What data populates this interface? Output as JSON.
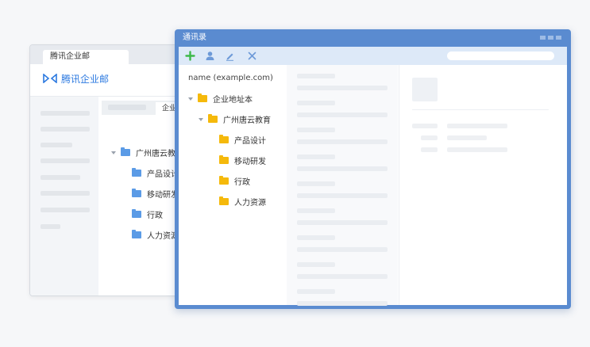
{
  "back_window": {
    "tab_title": "腾讯企业邮",
    "logo_text": "腾讯企业邮",
    "content_tab": "企业",
    "tree": {
      "root": "广州唐云教",
      "children": [
        "产品设计",
        "移动研发",
        "行政",
        "人力资源"
      ]
    }
  },
  "contacts_window": {
    "title": "通讯录",
    "toolbar": {
      "add_icon": "plus-icon",
      "user_icon": "user-icon",
      "edit_icon": "pen-icon",
      "delete_icon": "close-icon",
      "search_placeholder": ""
    },
    "tree": {
      "header": "name (example.com)",
      "root": "企业地址本",
      "org": "广州唐云教育",
      "departments": [
        "产品设计",
        "移动研发",
        "行政",
        "人力资源"
      ]
    }
  },
  "colors": {
    "window_blue": "#5a8bd0",
    "toolbar_blue": "#dde9f8",
    "folder_yellow": "#f5b90b",
    "folder_blue": "#5b9be6",
    "add_green": "#3db94a",
    "logo_blue": "#2d7ae0"
  }
}
